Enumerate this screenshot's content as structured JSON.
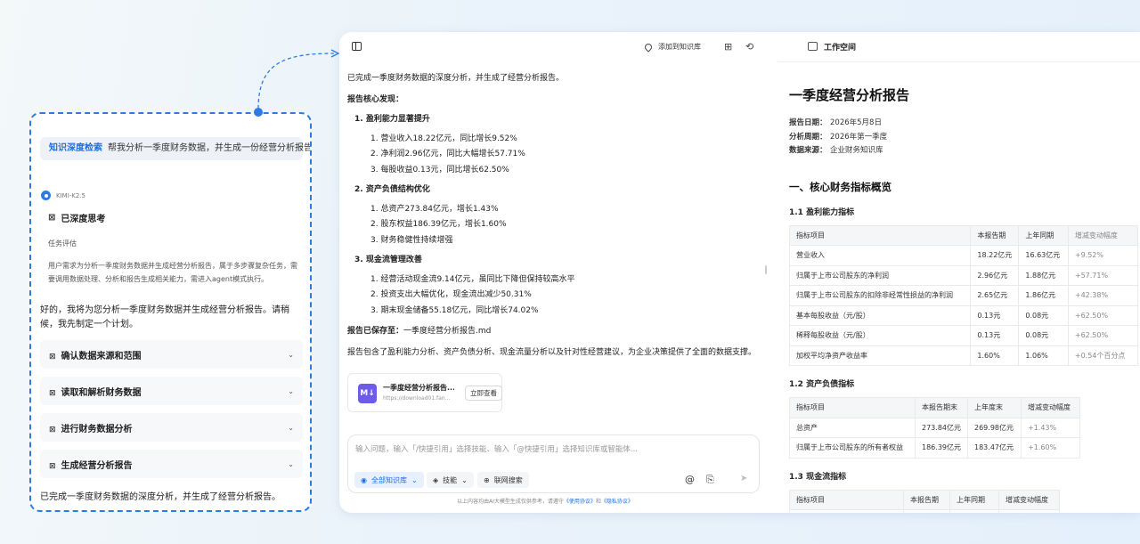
{
  "left_card": {
    "user_tag": "知识深度检索",
    "user_question": "帮我分析一季度财务数据，并生成一份经营分析报告。",
    "model_name": "KIMI-K2.5",
    "think_title": "已深度思考",
    "think_sub": "任务评估",
    "think_text": "用户需求为分析一季度财务数据并生成经营分析报告，属于多步骤复杂任务，需要调用数据处理、分析和报告生成相关能力，需进入agent模式执行。",
    "reply": "好的，我将为您分析一季度财务数据并生成经营分析报告。请稍候，我先制定一个计划。",
    "plan": [
      {
        "label": "确认数据来源和范围"
      },
      {
        "label": "读取和解析财务数据"
      },
      {
        "label": "进行财务数据分析"
      },
      {
        "label": "生成经营分析报告"
      }
    ],
    "footer": "已完成一季度财务数据的深度分析，并生成了经营分析报告。"
  },
  "chat": {
    "add_to_kb": "添加到知识库",
    "intro": "已完成一季度财务数据的深度分析，并生成了经营分析报告。",
    "findings_title": "报告核心发现：",
    "sections": [
      {
        "title": "1. 盈利能力显著提升",
        "items": [
          "1. 营业收入18.22亿元，同比增长9.52%",
          "2. 净利润2.96亿元，同比大幅增长57.71%",
          "3. 每股收益0.13元，同比增长62.50%"
        ]
      },
      {
        "title": "2. 资产负债结构优化",
        "items": [
          "1. 总资产273.84亿元，增长1.43%",
          "2. 股东权益186.39亿元，增长1.60%",
          "3. 财务稳健性持续增强"
        ]
      },
      {
        "title": "3. 现金流管理改善",
        "items": [
          "1. 经营活动现金流9.14亿元，虽同比下降但保持较高水平",
          "2. 投资支出大幅优化，现金流出减少50.31%",
          "3. 期末现金储备55.18亿元，同比增长74.02%"
        ]
      }
    ],
    "saved_label": "报告已保存至：",
    "saved_file": "一季度经营分析报告.md",
    "summary": "报告包含了盈利能力分析、资产负债分析、现金流量分析以及针对性经营建议，为企业决策提供了全面的数据支撑。",
    "file_card": {
      "name": "一季度经营分析报告...",
      "url": "https://download01.fan...",
      "button": "立即查看",
      "icon_text": "M↓"
    },
    "input_placeholder": "输入问题，输入「/快捷引用」选择技能、输入「@快捷引用」选择知识库或智能体...",
    "chips": {
      "kb": "全部知识库",
      "skills": "技能",
      "web": "联网搜索"
    },
    "disclaimer_pre": "以上内容均由AI大模型生成仅供参考，请遵守",
    "disclaimer_link1": "《使用协议》",
    "disclaimer_mid": "和",
    "disclaimer_link2": "《隐私协议》"
  },
  "workspace": {
    "title": "工作空间",
    "doc_title": "一季度经营分析报告",
    "meta": [
      {
        "k": "报告日期：",
        "v": "2026年5月8日"
      },
      {
        "k": "分析周期：",
        "v": "2026年第一季度"
      },
      {
        "k": "数据来源：",
        "v": "企业财务知识库"
      }
    ],
    "section1": "一、核心财务指标概览",
    "t1": {
      "title": "1.1 盈利能力指标",
      "headers": [
        "指标项目",
        "本报告期",
        "上年同期",
        "增减变动幅度"
      ],
      "rows": [
        [
          "营业收入",
          "18.22亿元",
          "16.63亿元",
          "+9.52%"
        ],
        [
          "归属于上市公司股东的净利润",
          "2.96亿元",
          "1.88亿元",
          "+57.71%"
        ],
        [
          "归属于上市公司股东的扣除非经常性损益的净利润",
          "2.65亿元",
          "1.86亿元",
          "+42.38%"
        ],
        [
          "基本每股收益（元/股）",
          "0.13元",
          "0.08元",
          "+62.50%"
        ],
        [
          "稀释每股收益（元/股）",
          "0.13元",
          "0.08元",
          "+62.50%"
        ],
        [
          "加权平均净资产收益率",
          "1.60%",
          "1.06%",
          "+0.54个百分点"
        ]
      ]
    },
    "t2": {
      "title": "1.2 资产负债指标",
      "headers": [
        "指标项目",
        "本报告期末",
        "上年度末",
        "增减变动幅度"
      ],
      "rows": [
        [
          "总资产",
          "273.84亿元",
          "269.98亿元",
          "+1.43%"
        ],
        [
          "归属于上市公司股东的所有者权益",
          "186.39亿元",
          "183.47亿元",
          "+1.60%"
        ]
      ]
    },
    "t3": {
      "title": "1.3 现金流指标",
      "headers": [
        "指标项目",
        "本报告期",
        "上年同期",
        "增减变动幅度"
      ]
    }
  }
}
